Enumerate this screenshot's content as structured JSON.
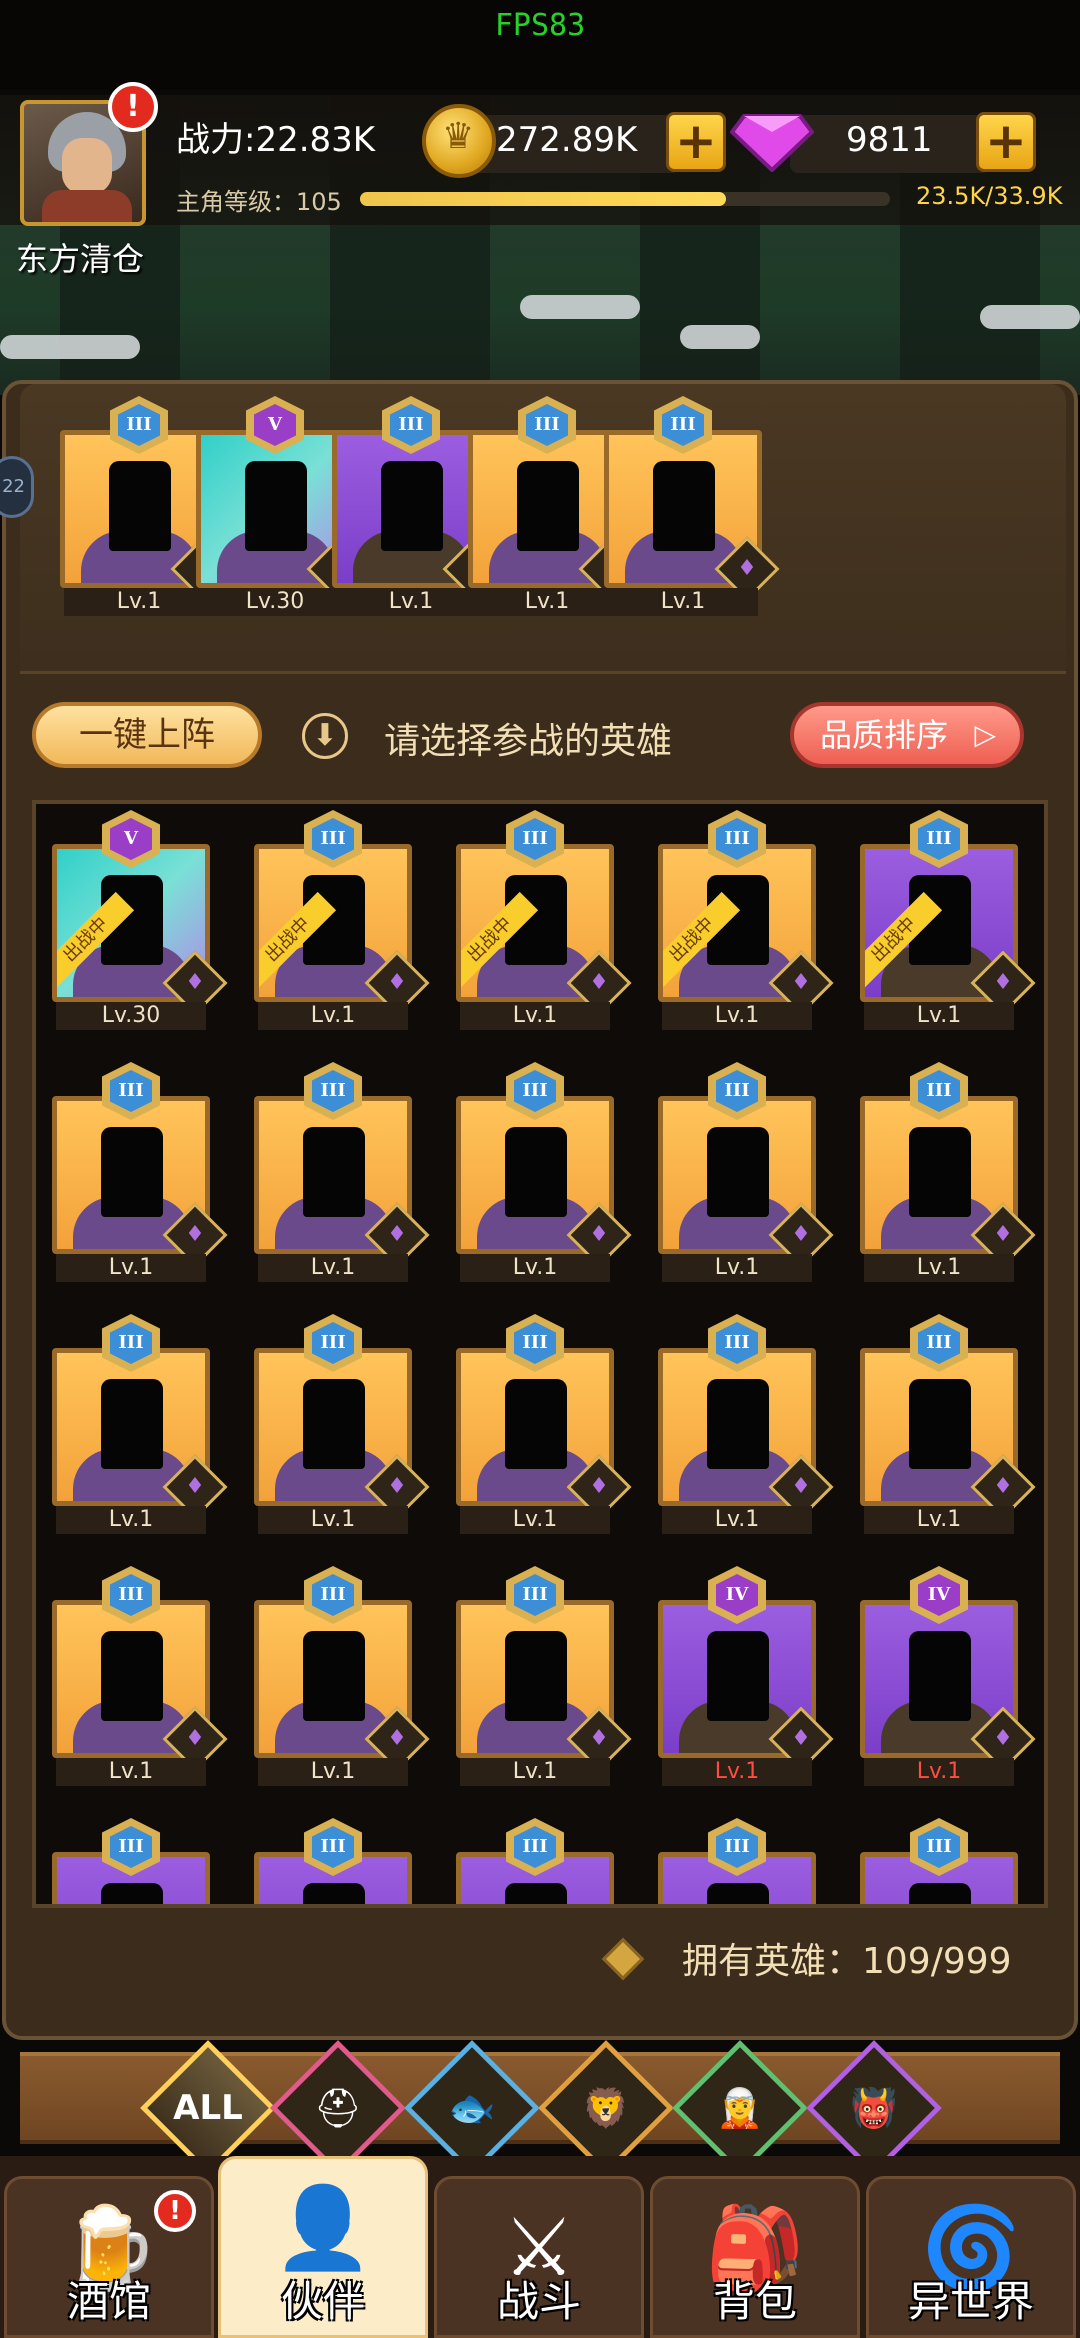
{
  "status": {
    "fps": "FPS83"
  },
  "header": {
    "power": "战力:22.83K",
    "gold": "272.89K",
    "gems": "9811",
    "level_label": "主角等级：105",
    "xp_text": "23.5K/33.9K",
    "xp_fraction": 0.69,
    "player_name": "东方清仓",
    "alert": "!"
  },
  "side_tab": "22",
  "team": [
    {
      "rank": "III",
      "level": "Lv.1",
      "bg": "gold"
    },
    {
      "rank": "V",
      "level": "Lv.30",
      "bg": "teal"
    },
    {
      "rank": "III",
      "level": "Lv.1",
      "bg": "purple"
    },
    {
      "rank": "III",
      "level": "Lv.1",
      "bg": "gold"
    },
    {
      "rank": "III",
      "level": "Lv.1",
      "bg": "gold"
    }
  ],
  "actions": {
    "oneclick": "一键上阵",
    "prompt": "请选择参战的英雄",
    "sort": "品质排序"
  },
  "deployed_tag": "出战中",
  "roster": [
    {
      "rank": "V",
      "level": "Lv.30",
      "bg": "teal",
      "deployed": true
    },
    {
      "rank": "III",
      "level": "Lv.1",
      "bg": "gold",
      "deployed": true
    },
    {
      "rank": "III",
      "level": "Lv.1",
      "bg": "gold",
      "deployed": true
    },
    {
      "rank": "III",
      "level": "Lv.1",
      "bg": "gold",
      "deployed": true
    },
    {
      "rank": "III",
      "level": "Lv.1",
      "bg": "purple",
      "deployed": true
    },
    {
      "rank": "III",
      "level": "Lv.1",
      "bg": "gold"
    },
    {
      "rank": "III",
      "level": "Lv.1",
      "bg": "gold"
    },
    {
      "rank": "III",
      "level": "Lv.1",
      "bg": "gold"
    },
    {
      "rank": "III",
      "level": "Lv.1",
      "bg": "gold"
    },
    {
      "rank": "III",
      "level": "Lv.1",
      "bg": "gold"
    },
    {
      "rank": "III",
      "level": "Lv.1",
      "bg": "gold"
    },
    {
      "rank": "III",
      "level": "Lv.1",
      "bg": "gold"
    },
    {
      "rank": "III",
      "level": "Lv.1",
      "bg": "gold"
    },
    {
      "rank": "III",
      "level": "Lv.1",
      "bg": "gold"
    },
    {
      "rank": "III",
      "level": "Lv.1",
      "bg": "gold"
    },
    {
      "rank": "III",
      "level": "Lv.1",
      "bg": "gold"
    },
    {
      "rank": "III",
      "level": "Lv.1",
      "bg": "gold"
    },
    {
      "rank": "III",
      "level": "Lv.1",
      "bg": "gold"
    },
    {
      "rank": "IV",
      "level": "Lv.1",
      "bg": "purple",
      "red": true
    },
    {
      "rank": "IV",
      "level": "Lv.1",
      "bg": "purple",
      "red": true
    },
    {
      "rank": "III",
      "level": "",
      "bg": "purple"
    },
    {
      "rank": "III",
      "level": "",
      "bg": "purple"
    },
    {
      "rank": "III",
      "level": "",
      "bg": "purple"
    },
    {
      "rank": "III",
      "level": "",
      "bg": "purple"
    },
    {
      "rank": "III",
      "level": "",
      "bg": "purple"
    }
  ],
  "owned": "拥有英雄：109/999",
  "filters": [
    "ALL"
  ],
  "tabs": [
    {
      "label": "酒馆",
      "icon": "🍺"
    },
    {
      "label": "伙伴",
      "icon": "👤"
    },
    {
      "label": "战斗",
      "icon": "⚔"
    },
    {
      "label": "背包",
      "icon": "🎒"
    },
    {
      "label": "异世界",
      "icon": "🌀"
    }
  ]
}
